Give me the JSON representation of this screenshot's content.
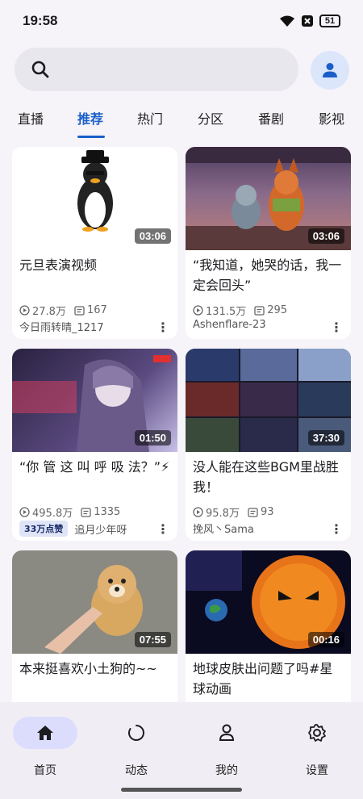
{
  "status": {
    "time": "19:58",
    "battery": "51"
  },
  "search": {
    "placeholder": ""
  },
  "tabs": [
    {
      "label": "直播"
    },
    {
      "label": "推荐"
    },
    {
      "label": "热门"
    },
    {
      "label": "分区"
    },
    {
      "label": "番剧"
    },
    {
      "label": "影视"
    }
  ],
  "active_tab": "推荐",
  "videos": [
    {
      "title": "元旦表演视频",
      "duration": "03:06",
      "views": "27.8万",
      "danmaku": "167",
      "author": "今日雨转晴_1217",
      "badge": ""
    },
    {
      "title": "“我知道，她哭的话，我一定会回头”",
      "duration": "03:06",
      "views": "131.5万",
      "danmaku": "295",
      "author": "Ashenflare-23",
      "badge": ""
    },
    {
      "title": "“你 管 这 叫 呼 吸 法？”⚡",
      "duration": "01:50",
      "views": "495.8万",
      "danmaku": "1335",
      "author": "追月少年呀",
      "badge": "33万点赞"
    },
    {
      "title": "没人能在这些BGM里战胜我！",
      "duration": "37:30",
      "views": "95.8万",
      "danmaku": "93",
      "author": "挽风丶Sama",
      "badge": ""
    },
    {
      "title": "本来挺喜欢小土狗的~~",
      "duration": "07:55"
    },
    {
      "title": "地球皮肤出问题了吗#星球动画",
      "duration": "00:16"
    }
  ],
  "bottom_nav": [
    {
      "label": "首页"
    },
    {
      "label": "动态"
    },
    {
      "label": "我的"
    },
    {
      "label": "设置"
    }
  ],
  "colors": {
    "accent": "#1a5fc8",
    "nav_active_bg": "#dcddfc"
  }
}
